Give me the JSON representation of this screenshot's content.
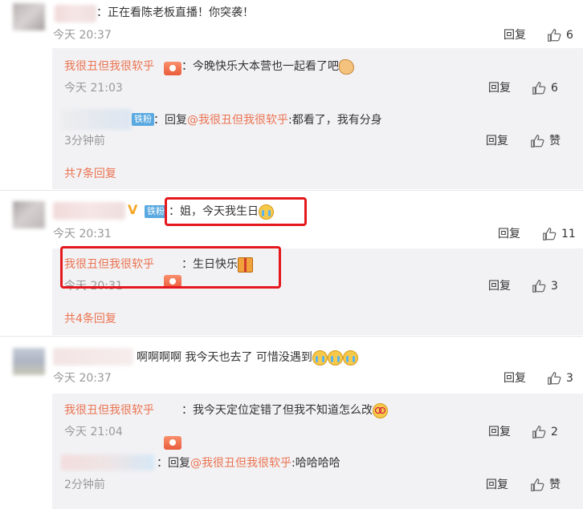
{
  "comments": [
    {
      "text": "：正在看陈老板直播！你突袭！",
      "time": "今天 20:37",
      "reply_label": "回复",
      "likes": "6",
      "replies": [
        {
          "author": "我很丑但我很软乎",
          "text": "：今晚快乐大本营也一起看了吧",
          "time": "今天 21:03",
          "reply_label": "回复",
          "likes": "6"
        },
        {
          "badge": "铁粉",
          "reply_prefix": "：回复",
          "mention": "@我很丑但我很软乎",
          "text": ":都看了，我有分身",
          "time": "3分钟前",
          "reply_label": "回复",
          "like_label": "赞"
        }
      ],
      "more": "共7条回复"
    },
    {
      "badge": "铁粉",
      "text": "：姐，今天我生日",
      "time": "今天 20:31",
      "reply_label": "回复",
      "likes": "11",
      "replies": [
        {
          "author": "我很丑但我很软乎",
          "text": "：生日快乐",
          "time": "今天 20:31",
          "reply_label": "回复",
          "likes": "3"
        }
      ],
      "more": "共4条回复"
    },
    {
      "text": "啊啊啊啊 我今天也去了 可惜没遇到",
      "time": "今天 20:37",
      "reply_label": "回复",
      "likes": "3",
      "replies": [
        {
          "author": "我很丑但我很软乎",
          "text": "：我今天定位定错了但我不知道怎么改",
          "time": "今天 21:04",
          "reply_label": "回复",
          "likes": "2"
        },
        {
          "reply_prefix": "：回复",
          "mention": "@我很丑但我很软乎",
          "text": ":哈哈哈哈",
          "time": "2分钟前",
          "reply_label": "回复",
          "like_label": "赞"
        }
      ]
    }
  ],
  "colors": {
    "accent": "#eb7350",
    "highlight_box": "#e5181d",
    "reply_bg": "#f2f2f5",
    "fan_badge": "#59a9e0"
  }
}
